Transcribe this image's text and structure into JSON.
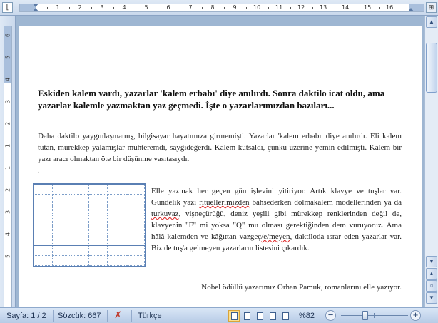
{
  "ruler": {
    "corner_glyph": "⌊",
    "h_numbers": [
      "1",
      "2",
      "3",
      "4",
      "5",
      "6",
      "7",
      "8",
      "9",
      "10",
      "11",
      "12",
      "13",
      "14",
      "15",
      "16"
    ],
    "v_numbers": [
      "6",
      "5",
      "4",
      "3",
      "2",
      "1",
      "1",
      "2",
      "3",
      "4",
      "5"
    ],
    "view_ruler_glyph": "⊞"
  },
  "document": {
    "heading": "Eskiden kalem vardı, yazarlar 'kalem erbabı' diye anılırdı. Sonra daktilo icat oldu, ama yazarlar kalemle yazmaktan yaz geçmedi. İşte o yazarlarımızdan bazıları...",
    "intro": "Daha daktilo yaygınlaşmamış, bilgisayar hayatımıza girmemişti. Yazarlar 'kalem erbabı' diye anılırdı. Eli kalem tutan, mürekkep yalamışlar muhteremdi, saygıdeğerdi. Kalem kutsaldı, çünkü üzerine yemin edilmişti. Kalem bir yazı aracı olmaktan öte bir düşünme vasıtasıydı.",
    "stray": ".",
    "body_part1": "Elle yazmak her geçen gün işlevini yitiriyor. Artık klavye ve tuşlar var. Gündelik yazı ",
    "body_err1": "ritüellerimizden",
    "body_part2": " bahsederken dolmakalem modellerinden ya da ",
    "body_err2": "turkuvaz",
    "body_part3": ", vişneçürüğü, deniz yeşili gibi mürekkep renklerinden değil de, klavyenin \"F\" mi yoksa \"Q\" mu olması gerektiğinden dem vuruyoruz. Ama hâlâ kalemden ve kâğıttan vazgeç",
    "body_err3": "/e/meyen",
    "body_part4": ", daktiloda ısrar eden yazarlar var. Biz de tuş'a gelmeyen yazarların listesini çıkardık.",
    "pamuk": "Nobel ödüllü yazarımız Orhan Pamuk, romanlarını elle yazıyor.",
    "table": {
      "rows": 8,
      "cols": 6
    }
  },
  "scrollbar": {
    "up_glyph": "▲",
    "down_glyph": "▼",
    "prev_glyph": "▲",
    "browse_glyph": "○",
    "next_glyph": "▼"
  },
  "statusbar": {
    "page": "Sayfa: 1 / 2",
    "words": "Sözcük: 667",
    "proof_glyph": "✗",
    "language": "Türkçe",
    "zoom": "%82",
    "zoom_out": "−",
    "zoom_in": "+",
    "zoom_level": 0.82
  }
}
